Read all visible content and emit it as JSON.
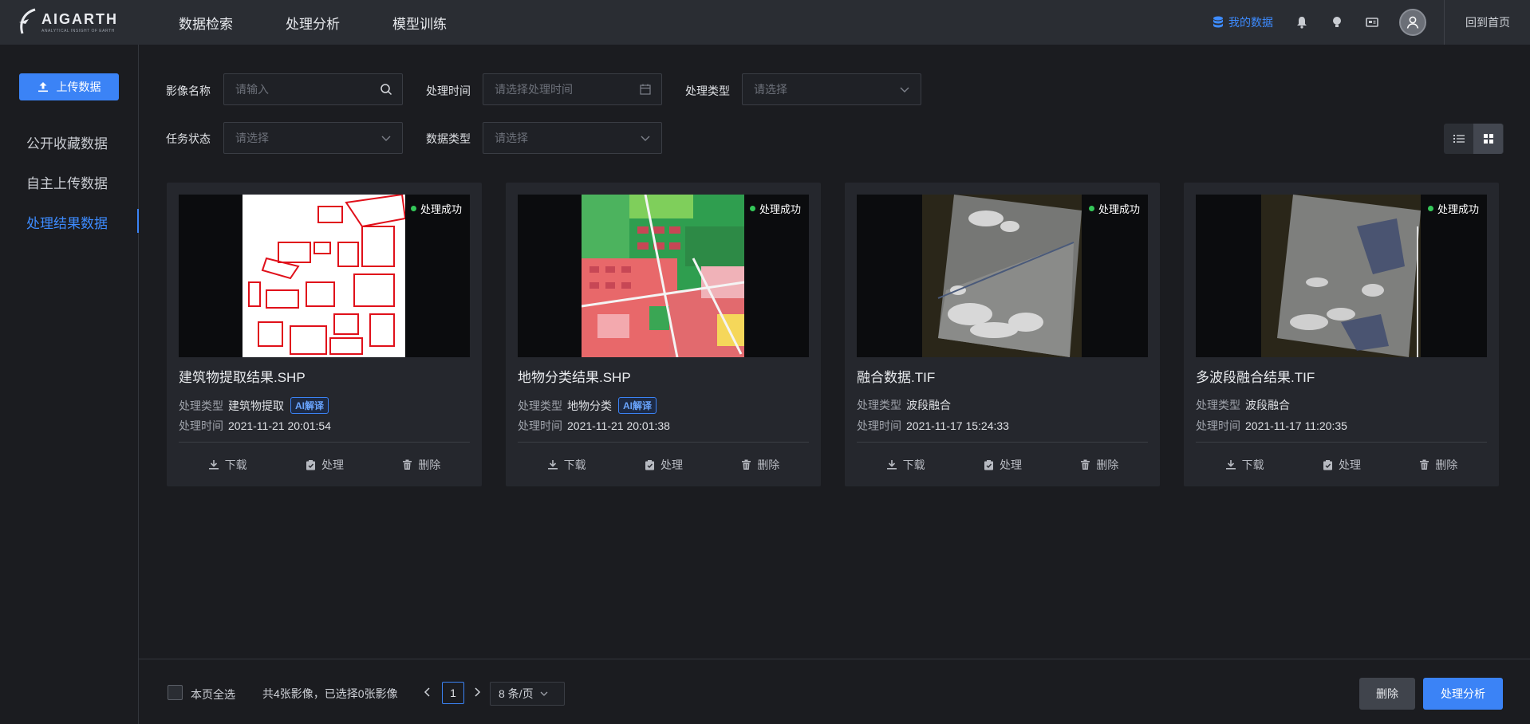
{
  "header": {
    "logo_text": "AIGARTH",
    "logo_sub": "ANALYTICAL INSIGHT OF EARTH",
    "nav": [
      "数据检索",
      "处理分析",
      "模型训练"
    ],
    "my_data": "我的数据",
    "home": "回到首页",
    "accent": "#3b83f6"
  },
  "sidebar": {
    "upload": "上传数据",
    "items": [
      {
        "label": "公开收藏数据",
        "active": false
      },
      {
        "label": "自主上传数据",
        "active": false
      },
      {
        "label": "处理结果数据",
        "active": true
      }
    ]
  },
  "filters": {
    "image_name_label": "影像名称",
    "image_name_placeholder": "请输入",
    "time_label": "处理时间",
    "time_placeholder": "请选择处理时间",
    "type_label": "处理类型",
    "type_placeholder": "请选择",
    "status_label": "任务状态",
    "status_placeholder": "请选择",
    "data_type_label": "数据类型",
    "data_type_placeholder": "请选择"
  },
  "cards": [
    {
      "title": "建筑物提取结果.SHP",
      "status": "处理成功",
      "type_label": "处理类型",
      "type": "建筑物提取",
      "ai_badge": "AI解译",
      "time_label": "处理时间",
      "time": "2021-11-21 20:01:54",
      "thumb": "building"
    },
    {
      "title": "地物分类结果.SHP",
      "status": "处理成功",
      "type_label": "处理类型",
      "type": "地物分类",
      "ai_badge": "AI解译",
      "time_label": "处理时间",
      "time": "2021-11-21 20:01:38",
      "thumb": "landcover"
    },
    {
      "title": "融合数据.TIF",
      "status": "处理成功",
      "type_label": "处理类型",
      "type": "波段融合",
      "ai_badge": "",
      "time_label": "处理时间",
      "time": "2021-11-17 15:24:33",
      "thumb": "satellite1"
    },
    {
      "title": "多波段融合结果.TIF",
      "status": "处理成功",
      "type_label": "处理类型",
      "type": "波段融合",
      "ai_badge": "",
      "time_label": "处理时间",
      "time": "2021-11-17 11:20:35",
      "thumb": "satellite2"
    }
  ],
  "card_actions": {
    "download": "下载",
    "process": "处理",
    "delete": "删除"
  },
  "footer": {
    "select_all": "本页全选",
    "summary": "共4张影像，已选择0张影像",
    "page": "1",
    "page_size": "8 条/页",
    "delete": "删除",
    "analyze": "处理分析"
  }
}
